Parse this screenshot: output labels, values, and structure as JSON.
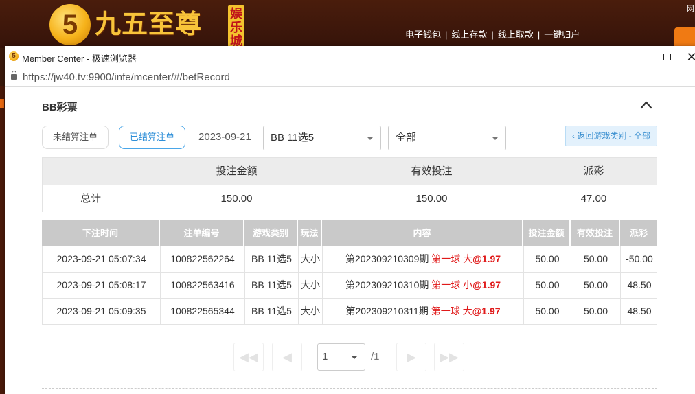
{
  "site": {
    "logo_glyph": "5",
    "logo_text": "九五至尊",
    "logo_tag": "娱乐城",
    "top_links": [
      "电子钱包",
      "线上存款",
      "线上取款",
      "一键归户"
    ],
    "corner_label": "网"
  },
  "window": {
    "title": "Member Center - 极速浏览器",
    "url": "https://jw40.tv:9900/infe/mcenter/#/betRecord",
    "controls": {
      "minimize": "minimize-icon",
      "maximize": "maximize-icon",
      "close": "✕"
    }
  },
  "section": {
    "title": "BB彩票",
    "collapse_icon": "chevron-up-icon"
  },
  "filters": {
    "unsettled_label": "未结算注单",
    "settled_label": "已结算注单",
    "date": "2023-09-21",
    "game_select": "BB 11选5",
    "type_select": "全部",
    "back_link": "‹ 返回游戏类别 - 全部"
  },
  "summary": {
    "headers": [
      "",
      "投注金额",
      "有效投注",
      "派彩"
    ],
    "row": [
      "总计",
      "150.00",
      "150.00",
      "47.00"
    ]
  },
  "records": {
    "headers": [
      "下注时间",
      "注单编号",
      "游戏类别",
      "玩法",
      "内容",
      "投注金额",
      "有效投注",
      "派彩"
    ],
    "rows": [
      {
        "time": "2023-09-21 05:07:34",
        "id": "100822562264",
        "game": "BB 11选5",
        "play": "大小",
        "period": "第202309210309期",
        "pick": "第一球 大",
        "odds": "@1.97",
        "bet": "50.00",
        "valid": "50.00",
        "payout": "-50.00"
      },
      {
        "time": "2023-09-21 05:08:17",
        "id": "100822563416",
        "game": "BB 11选5",
        "play": "大小",
        "period": "第202309210310期",
        "pick": "第一球 小",
        "odds": "@1.97",
        "bet": "50.00",
        "valid": "50.00",
        "payout": "48.50"
      },
      {
        "time": "2023-09-21 05:09:35",
        "id": "100822565344",
        "game": "BB 11选5",
        "play": "大小",
        "period": "第202309210311期",
        "pick": "第一球 大",
        "odds": "@1.97",
        "bet": "50.00",
        "valid": "50.00",
        "payout": "48.50"
      }
    ]
  },
  "pagination": {
    "first": "◀◀",
    "prev": "◀",
    "next": "▶",
    "last": "▶▶",
    "current": "1",
    "total": "/1"
  },
  "colors": {
    "accent_blue": "#2f8fd8",
    "highlight_red": "#e01a1a",
    "header_gray": "#c9c9c9"
  }
}
